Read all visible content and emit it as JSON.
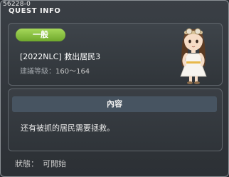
{
  "window": {
    "quest_id": "56228-0",
    "title": "QUEST INFO"
  },
  "info": {
    "category": "一般",
    "quest_name": "[2022NLC] 救出居民3",
    "level_label": "建議等級：",
    "level_range": "160～164",
    "npc_icon": "npc-girl-portrait"
  },
  "content": {
    "header": "內容",
    "description": "还有被抓的居民需要拯救。"
  },
  "status": {
    "label": "狀態：",
    "value": "可開始"
  },
  "colors": {
    "badge_green": "#8cc63f",
    "panel_border": "#61676d",
    "header_bg": "#475461"
  }
}
